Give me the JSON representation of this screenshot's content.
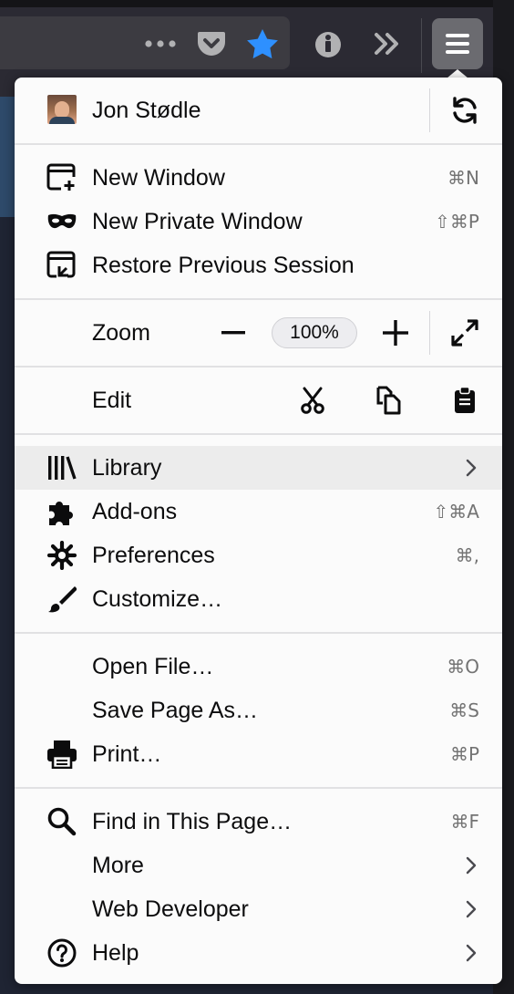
{
  "toolbar": {
    "page_actions": "more-dots-icon",
    "pocket": "pocket-icon",
    "bookmark": "star-icon",
    "extension": "info-icon",
    "overflow": "chevron-double-icon",
    "menu": "hamburger-icon",
    "accent": "#2e90ff"
  },
  "menu": {
    "account": {
      "name": "Jon Stødle",
      "sync_icon": "sync-icon"
    },
    "new_window": {
      "label": "New Window",
      "shortcut": "⌘N"
    },
    "private_window": {
      "label": "New Private Window",
      "shortcut": "⇧⌘P"
    },
    "restore": {
      "label": "Restore Previous Session"
    },
    "zoom": {
      "label": "Zoom",
      "value": "100%",
      "minus": "−",
      "plus": "+"
    },
    "edit": {
      "label": "Edit"
    },
    "library": {
      "label": "Library"
    },
    "addons": {
      "label": "Add-ons",
      "shortcut": "⇧⌘A"
    },
    "preferences": {
      "label": "Preferences",
      "shortcut": "⌘,"
    },
    "customize": {
      "label": "Customize…"
    },
    "open_file": {
      "label": "Open File…",
      "shortcut": "⌘O"
    },
    "save_page": {
      "label": "Save Page As…",
      "shortcut": "⌘S"
    },
    "print": {
      "label": "Print…",
      "shortcut": "⌘P"
    },
    "find": {
      "label": "Find in This Page…",
      "shortcut": "⌘F"
    },
    "more": {
      "label": "More"
    },
    "web_developer": {
      "label": "Web Developer"
    },
    "help": {
      "label": "Help"
    }
  }
}
